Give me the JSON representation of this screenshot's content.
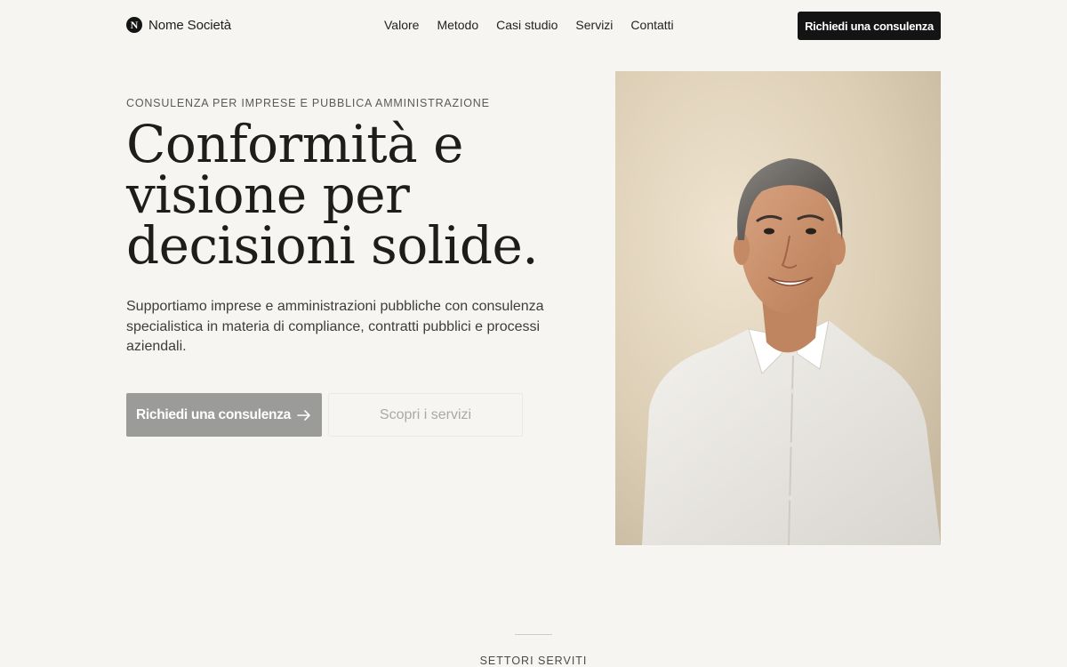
{
  "header": {
    "logo_letter": "N",
    "brand_name": "Nome Società",
    "nav": [
      "Valore",
      "Metodo",
      "Casi studio",
      "Servizi",
      "Contatti"
    ],
    "cta_label": "Richiedi una consulenza"
  },
  "hero": {
    "eyebrow": "CONSULENZA PER IMPRESE E PUBBLICA AMMINISTRAZIONE",
    "headline_lines": [
      "Conformità e",
      "visione per",
      "decisioni solide."
    ],
    "lead": "Supportiamo imprese e amministrazioni pubbliche con consulenza specialistica in materia di compliance, contratti pubblici e processi aziendali.",
    "primary_cta": "Richiedi una consulenza",
    "primary_cta_icon": "arrow-right-icon",
    "secondary_cta": "Scopri i servizi"
  },
  "sectors": {
    "label": "SETTORI SERVITI"
  },
  "colors": {
    "background": "#f6f5f2",
    "dark": "#141414",
    "primary_button_muted": "#9b9b99",
    "text": "#1d1d1b"
  }
}
